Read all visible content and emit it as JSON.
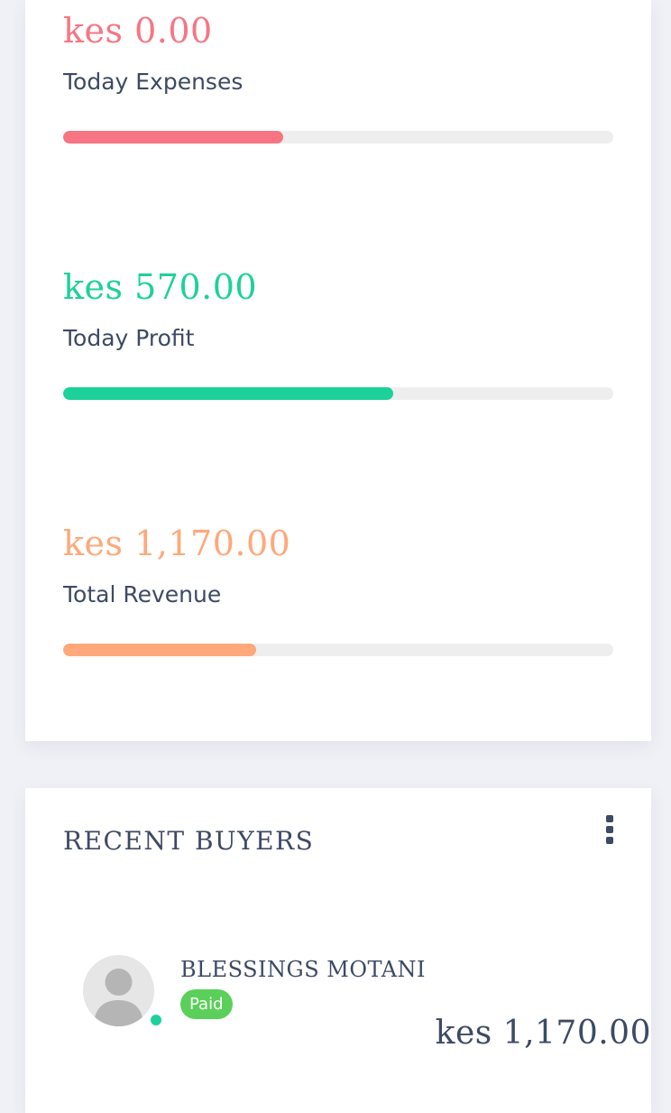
{
  "stats": {
    "expenses": {
      "amount": "kes 0.00",
      "label": "Today Expenses",
      "progress": 0.4,
      "color": "#f77583"
    },
    "profit": {
      "amount": "kes 570.00",
      "label": "Today Profit",
      "progress": 0.6,
      "color": "#1dd19a"
    },
    "revenue": {
      "amount": "kes 1,170.00",
      "label": "Total Revenue",
      "progress": 0.35,
      "color": "#ffa87a"
    }
  },
  "recent_buyers": {
    "title": "RECENT BUYERS",
    "menu_icon": "kebab-menu-icon",
    "buyers": [
      {
        "name": "BLESSINGS MOTANI",
        "status": "Paid",
        "amount": "kes 1,170.00",
        "avatar_icon": "user-silhouette-icon",
        "online": true
      }
    ]
  },
  "colors": {
    "status_paid": "#5ad05a",
    "online": "#1dd19a",
    "text": "#3d4a63"
  }
}
